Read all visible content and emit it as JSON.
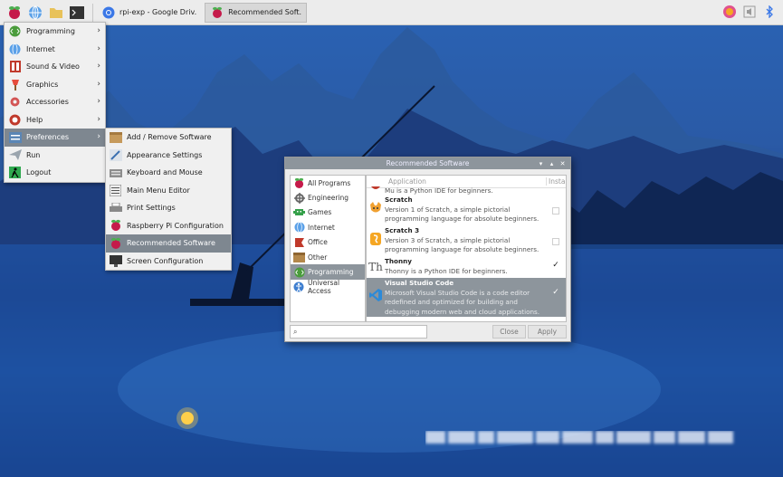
{
  "colors": {
    "taskbar_bg": "#ececec",
    "menu_bg": "#f0f0f0",
    "highlight": "#7e8790",
    "window_title": "#8d959c",
    "raspberry": "#c51a4a"
  },
  "taskbar": {
    "launchers": [
      {
        "icon": "raspberry-menu-icon"
      },
      {
        "icon": "web-browser-icon"
      },
      {
        "icon": "file-manager-icon"
      },
      {
        "icon": "terminal-icon"
      }
    ],
    "tasks": [
      {
        "label": "rpi-exp - Google Driv.",
        "icon": "chrome-icon",
        "active": false
      },
      {
        "label": "Recommended Soft.",
        "icon": "raspberry-icon",
        "active": true
      }
    ],
    "tray": [
      {
        "icon": "color-picker-icon"
      },
      {
        "icon": "volume-icon"
      },
      {
        "icon": "bluetooth-icon"
      }
    ]
  },
  "main_menu": {
    "items": [
      {
        "label": "Programming",
        "icon": "programming-icon",
        "submenu": true
      },
      {
        "label": "Internet",
        "icon": "internet-icon",
        "submenu": true
      },
      {
        "label": "Sound & Video",
        "icon": "sound-video-icon",
        "submenu": true
      },
      {
        "label": "Graphics",
        "icon": "graphics-icon",
        "submenu": true
      },
      {
        "label": "Accessories",
        "icon": "accessories-icon",
        "submenu": true
      },
      {
        "label": "Help",
        "icon": "help-icon",
        "submenu": true
      },
      {
        "label": "Preferences",
        "icon": "preferences-icon",
        "submenu": true,
        "highlighted": true
      },
      {
        "label": "Run",
        "icon": "run-icon",
        "submenu": false
      },
      {
        "label": "Logout",
        "icon": "logout-icon",
        "submenu": false
      }
    ]
  },
  "preferences_menu": {
    "items": [
      {
        "label": "Add / Remove Software",
        "icon": "package-icon"
      },
      {
        "label": "Appearance Settings",
        "icon": "appearance-icon"
      },
      {
        "label": "Keyboard and Mouse",
        "icon": "keyboard-icon"
      },
      {
        "label": "Main Menu Editor",
        "icon": "menu-editor-icon"
      },
      {
        "label": "Print Settings",
        "icon": "printer-icon"
      },
      {
        "label": "Raspberry Pi Configuration",
        "icon": "raspberry-icon"
      },
      {
        "label": "Recommended Software",
        "icon": "raspberry-icon",
        "highlighted": true
      },
      {
        "label": "Screen Configuration",
        "icon": "monitor-icon"
      }
    ]
  },
  "window": {
    "title": "Recommended Software",
    "categories": [
      {
        "label": "All Programs",
        "icon": "raspberry-icon"
      },
      {
        "label": "Engineering",
        "icon": "engineering-icon"
      },
      {
        "label": "Games",
        "icon": "games-icon"
      },
      {
        "label": "Internet",
        "icon": "internet-icon"
      },
      {
        "label": "Office",
        "icon": "office-icon"
      },
      {
        "label": "Other",
        "icon": "other-icon"
      },
      {
        "label": "Programming",
        "icon": "programming-icon",
        "highlighted": true
      },
      {
        "label": "Universal Access",
        "icon": "universal-access-icon"
      }
    ],
    "columns": {
      "application": "Application",
      "install": "Install"
    },
    "apps": [
      {
        "name": "",
        "description": "Mu is a Python IDE for beginners.",
        "icon": "mu-icon",
        "installed": false,
        "partial": true
      },
      {
        "name": "Scratch",
        "description": "Version 1 of Scratch, a simple pictorial programming language for absolute beginners.",
        "icon": "scratch-icon",
        "installed": false
      },
      {
        "name": "Scratch 3",
        "description": "Version 3 of Scratch, a simple pictorial programming language for absolute beginners.",
        "icon": "scratch3-icon",
        "installed": false
      },
      {
        "name": "Thonny",
        "description": "Thonny is a Python IDE for beginners.",
        "icon": "thonny-icon",
        "installed": true
      },
      {
        "name": "Visual Studio Code",
        "description": "Microsoft Visual Studio Code is a code editor redefined and optimized for building and debugging modern web and cloud applications.",
        "icon": "vscode-icon",
        "installed": true,
        "highlighted": true
      }
    ],
    "search": {
      "value": ""
    },
    "close_label": "Close",
    "apply_label": "Apply"
  }
}
